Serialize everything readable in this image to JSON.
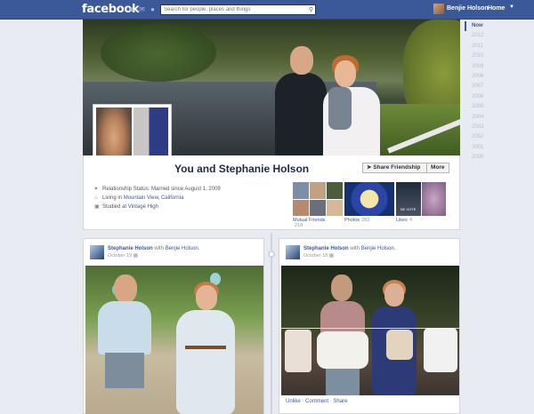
{
  "topbar": {
    "logo": "facebook",
    "search_placeholder": "Search for people, places and things",
    "user_name": "Benjie Holson",
    "home_label": "Home",
    "brand_color": "#3b5998"
  },
  "timeline_years": [
    "Now",
    "2012",
    "2011",
    "2010",
    "2009",
    "2008",
    "2007",
    "2006",
    "2005",
    "2004",
    "2003",
    "2002",
    "2001",
    "2000"
  ],
  "profile": {
    "name": "You and Stephanie Holson",
    "share_button": "Share Friendship",
    "more_button": "More",
    "details": [
      {
        "icon": "heart-icon",
        "text": "Relationship Status: Married since August 1, 2009"
      },
      {
        "icon": "home-icon",
        "prefix": "Living in ",
        "link1": "Mountain View",
        "sep": ", ",
        "link2": "California"
      },
      {
        "icon": "school-icon",
        "prefix": "Studied at ",
        "link1": "Vintage High"
      }
    ],
    "tiles": [
      {
        "label": "Mutual Friends",
        "count": "218"
      },
      {
        "label": "Photos",
        "count": "283"
      },
      {
        "label": "Likes",
        "count": "4"
      }
    ],
    "likes_tile_text": "BE VOTE"
  },
  "posts": [
    {
      "author": "Stephanie Holson",
      "with": "with",
      "tagged": "Benjie Holson.",
      "date": "October 19"
    },
    {
      "author": "Stephanie Holson",
      "with": "with",
      "tagged": "Benjie Holson.",
      "date": "October 18",
      "actions": [
        "Unlike",
        "Comment",
        "Share"
      ]
    }
  ]
}
